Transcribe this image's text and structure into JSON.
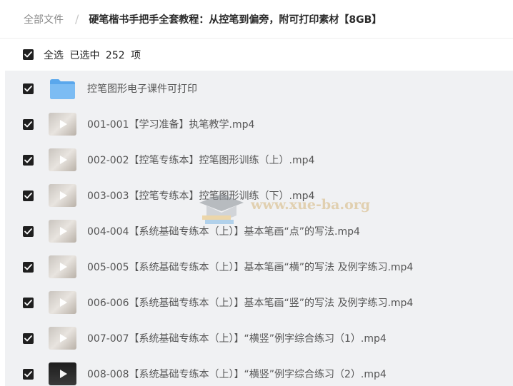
{
  "breadcrumb": {
    "root": "全部文件",
    "separator": "/",
    "current": "硬笔楷书手把手全套教程：从控笔到偏旁，附可打印素材【8GB】"
  },
  "select_bar": {
    "select_all_label": "全选",
    "selected_prefix": "已选中",
    "selected_count": "252",
    "selected_suffix": "项",
    "checked": true
  },
  "watermark": {
    "text": "www.xue-ba.org"
  },
  "files": [
    {
      "type": "folder",
      "name": "控笔图形电子课件可打印",
      "checked": true,
      "thumb_icon": "folder-icon"
    },
    {
      "type": "video",
      "name": "001-001【学习准备】执笔教学.mp4",
      "checked": true,
      "thumb_icon": "video-thumbnail-icon"
    },
    {
      "type": "video",
      "name": "002-002【控笔专练本】控笔图形训练（上）.mp4",
      "checked": true,
      "thumb_icon": "video-thumbnail-icon"
    },
    {
      "type": "video",
      "name": "003-003【控笔专练本】控笔图形训练（下）.mp4",
      "checked": true,
      "thumb_icon": "video-thumbnail-icon"
    },
    {
      "type": "video",
      "name": "004-004【系统基础专练本（上）】基本笔画“点”的写法.mp4",
      "checked": true,
      "thumb_icon": "video-thumbnail-icon"
    },
    {
      "type": "video",
      "name": "005-005【系统基础专练本（上）】基本笔画“横”的写法 及例字练习.mp4",
      "checked": true,
      "thumb_icon": "video-thumbnail-icon"
    },
    {
      "type": "video",
      "name": "006-006【系统基础专练本（上）】基本笔画“竖”的写法 及例字练习.mp4",
      "checked": true,
      "thumb_icon": "video-thumbnail-icon"
    },
    {
      "type": "video",
      "name": "007-007【系统基础专练本（上）】“横竖”例字综合练习（1）.mp4",
      "checked": true,
      "thumb_icon": "video-thumbnail-icon"
    },
    {
      "type": "video",
      "name": "008-008【系统基础专练本（上）】“横竖”例字综合练习（2）.mp4",
      "checked": true,
      "thumb_icon": "video-thumbnail-icon"
    }
  ]
}
